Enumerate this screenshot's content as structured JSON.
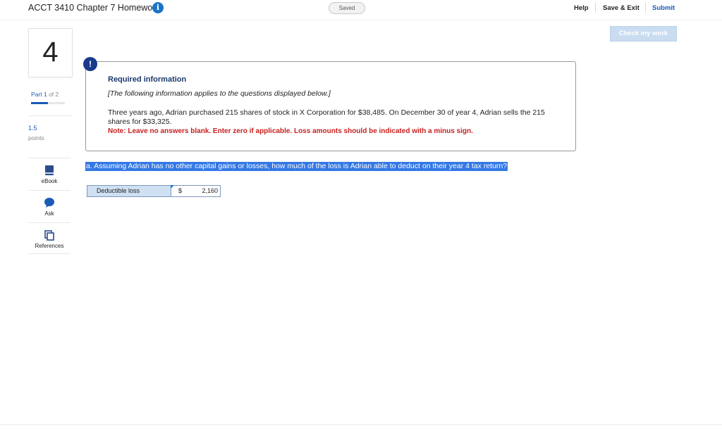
{
  "header": {
    "title": "ACCT 3410 Chapter 7 Homework",
    "info_icon": "info-icon",
    "status": "Saved",
    "help_label": "Help",
    "save_exit_label": "Save & Exit",
    "submit_label": "Submit",
    "check_label": "Check my work"
  },
  "question": {
    "number": "4",
    "part_prefix": "Part",
    "part_current": "1",
    "part_of": "of 2",
    "part_progress_fraction": 0.5,
    "points_value": "1.5",
    "points_label": "points"
  },
  "tools": [
    {
      "label": "eBook",
      "icon": "book-icon"
    },
    {
      "label": "Ask",
      "icon": "chat-bubble-icon"
    },
    {
      "label": "References",
      "icon": "copy-documents-icon"
    }
  ],
  "required_info": {
    "alert_glyph": "!",
    "title": "Required information",
    "intro": "[The following information applies to the questions displayed below.]",
    "body": "Three years ago, Adrian purchased 215 shares of stock in X Corporation for $38,485. On December 30 of year 4, Adrian sells the 215 shares for $33,325.",
    "note": "Note: Leave no answers blank. Enter zero if applicable. Loss amounts should be indicated with a minus sign."
  },
  "part_a": {
    "prompt": "a. Assuming Adrian has no other capital gains or losses, how much of the loss is Adrian able to deduct on their year 4 tax return?",
    "row_label": "Deductible loss",
    "currency": "$",
    "answer": "2,160"
  },
  "colors": {
    "accent": "#1a5bb5",
    "highlight": "#3478e5",
    "note_red": "#c81f1f",
    "alert_navy": "#1a3a8c"
  }
}
